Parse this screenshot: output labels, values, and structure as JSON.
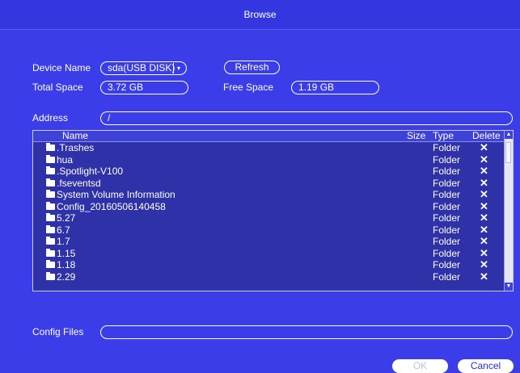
{
  "dialog": {
    "title": "Browse"
  },
  "device": {
    "name_label": "Device Name",
    "name_value": "sda(USB DISK)",
    "dropdown_glyph": "▾",
    "refresh_label": "Refresh",
    "total_space_label": "Total Space",
    "total_space_value": "3.72 GB",
    "free_space_label": "Free Space",
    "free_space_value": "1.19 GB"
  },
  "address": {
    "label": "Address",
    "value": "/"
  },
  "table": {
    "columns": {
      "name": "Name",
      "size": "Size",
      "type": "Type",
      "delete": "Delete"
    },
    "rows": [
      {
        "name": ".Trashes",
        "type": "Folder",
        "delete": "✕"
      },
      {
        "name": "hua",
        "type": "Folder",
        "delete": "✕"
      },
      {
        "name": ".Spotlight-V100",
        "type": "Folder",
        "delete": "✕"
      },
      {
        "name": ".fseventsd",
        "type": "Folder",
        "delete": "✕"
      },
      {
        "name": "System Volume Information",
        "type": "Folder",
        "delete": "✕"
      },
      {
        "name": "Config_20160506140458",
        "type": "Folder",
        "delete": "✕"
      },
      {
        "name": "5.27",
        "type": "Folder",
        "delete": "✕"
      },
      {
        "name": "6.7",
        "type": "Folder",
        "delete": "✕"
      },
      {
        "name": "1.7",
        "type": "Folder",
        "delete": "✕"
      },
      {
        "name": "1.15",
        "type": "Folder",
        "delete": "✕"
      },
      {
        "name": "1.18",
        "type": "Folder",
        "delete": "✕"
      },
      {
        "name": "2.29",
        "type": "Folder",
        "delete": "✕"
      }
    ],
    "scroll_up_glyph": "▲",
    "scroll_down_glyph": "▼"
  },
  "config_files": {
    "label": "Config Files",
    "value": ""
  },
  "footer": {
    "ok_label": "OK",
    "cancel_label": "Cancel"
  },
  "colors": {
    "background": "#3a3de8",
    "list_background": "#2e31a8"
  }
}
